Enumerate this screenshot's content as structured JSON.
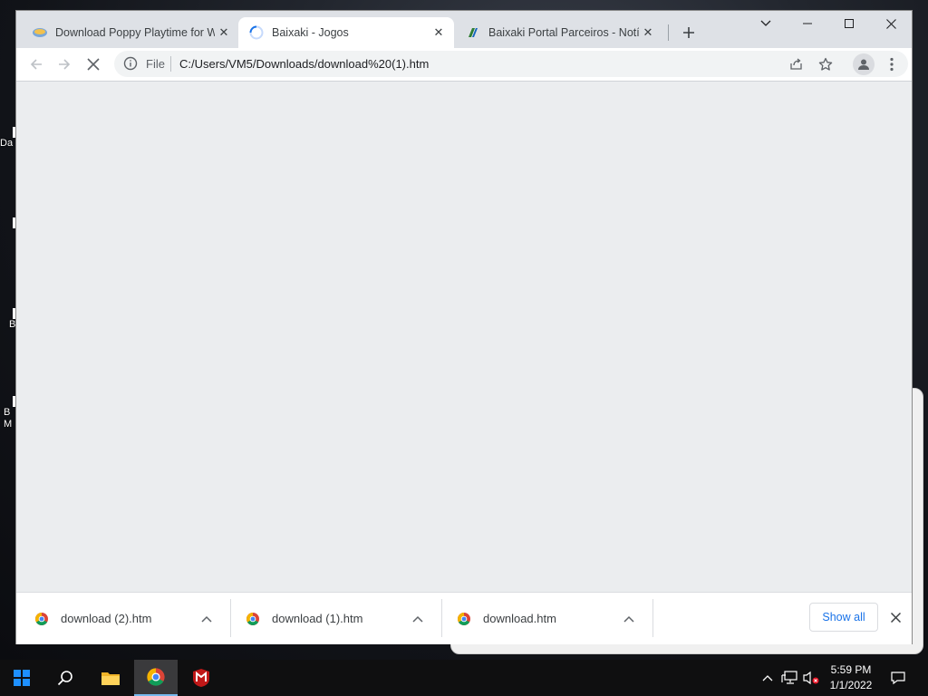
{
  "desktop": {
    "labels": [
      "Da",
      "B",
      "B\nM"
    ]
  },
  "browser": {
    "tabs": [
      {
        "title": "Download Poppy Playtime for W",
        "favicon": "baixaki-favicon",
        "active": false
      },
      {
        "title": "Baixaki - Jogos",
        "favicon": "loading-spinner-icon",
        "active": true
      },
      {
        "title": "Baixaki Portal Parceiros - Notícia",
        "favicon": "baixaki-portal-favicon",
        "active": false
      }
    ],
    "new_tab_icon": "plus-icon",
    "window_controls": [
      "tab-search-icon",
      "minimize-icon",
      "maximize-icon",
      "close-icon"
    ],
    "omnibox": {
      "scheme_label": "File",
      "url": "C:/Users/VM5/Downloads/download%20(1).htm"
    },
    "downloads": [
      {
        "name": "download (2).htm"
      },
      {
        "name": "download (1).htm"
      },
      {
        "name": "download.htm"
      }
    ],
    "show_all_label": "Show all",
    "accent_color": "#1a73e8"
  },
  "taskbar": {
    "time": "5:59 PM",
    "date": "1/1/2022",
    "apps": [
      "start-icon",
      "search-icon",
      "file-explorer-icon",
      "chrome-icon",
      "mcafee-icon"
    ]
  }
}
